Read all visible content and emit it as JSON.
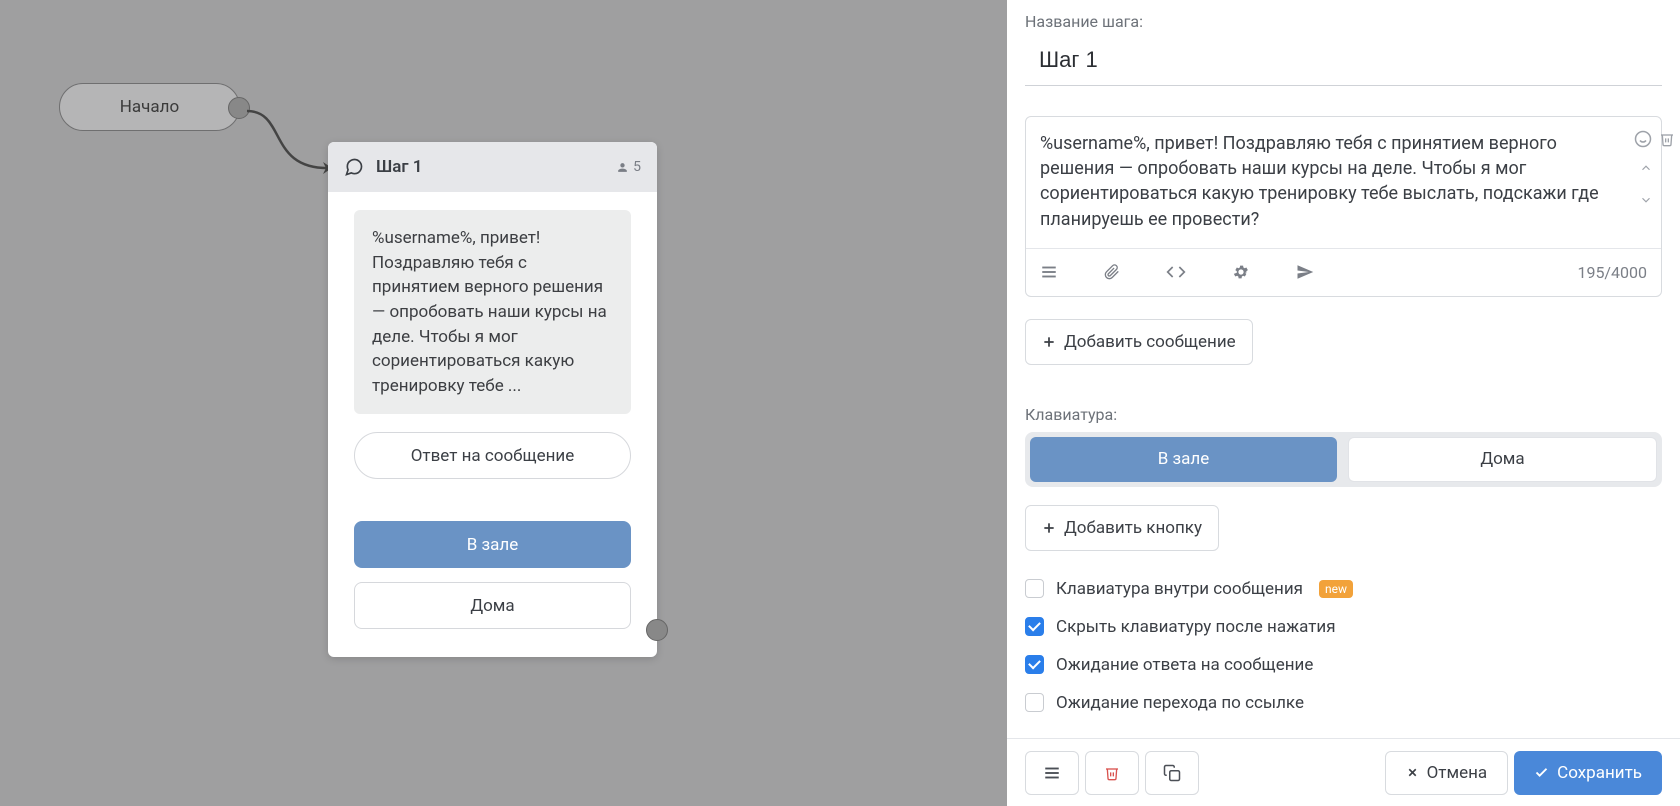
{
  "canvas": {
    "start_label": "Начало",
    "step": {
      "title": "Шаг 1",
      "user_count": "5",
      "message_preview": "%username%, привет! Поздравляю тебя с принятием верного решения — опробовать наши курсы на деле. Чтобы я мог сориентироваться какую тренировку тебе ...",
      "reply_label": "Ответ на сообщение",
      "buttons": [
        "В зале",
        "Дома"
      ]
    }
  },
  "panel": {
    "name_label": "Название шага:",
    "name_value": "Шаг 1",
    "message_text": "%username%, привет! Поздравляю тебя с принятием верного решения  —  опробовать наши курсы на деле. Чтобы я мог сориентироваться какую тренировку тебе выслать, подскажи где планируешь ее провести?",
    "char_counter": "195/4000",
    "add_message_label": "Добавить сообщение",
    "keyboard_label": "Клавиатура:",
    "keyboard_buttons": [
      "В зале",
      "Дома"
    ],
    "add_button_label": "Добавить кнопку",
    "checkboxes": {
      "inline_keyboard": {
        "label": "Клавиатура внутри сообщения",
        "badge": "new",
        "checked": false
      },
      "hide_keyboard": {
        "label": "Скрыть клавиатуру после нажатия",
        "checked": true
      },
      "wait_reply": {
        "label": "Ожидание ответа на сообщение",
        "checked": true
      },
      "wait_link": {
        "label": "Ожидание перехода по ссылке",
        "checked": false
      }
    },
    "footer": {
      "cancel_label": "Отмена",
      "save_label": "Сохранить"
    }
  }
}
